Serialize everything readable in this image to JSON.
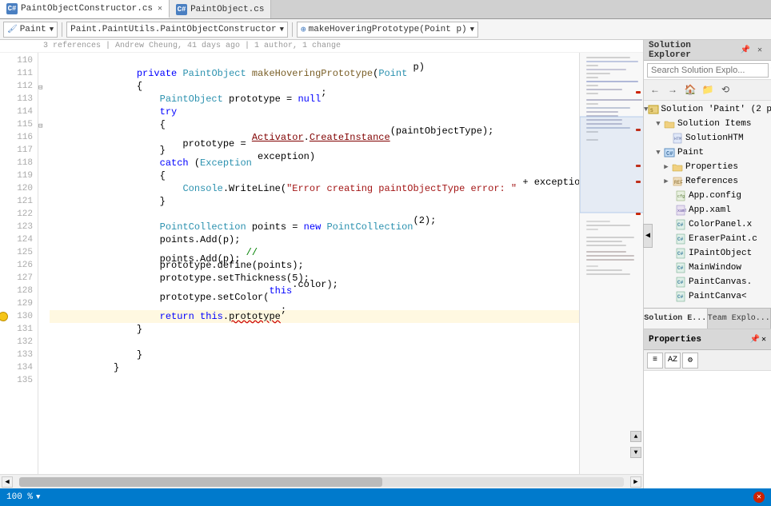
{
  "tabs": [
    {
      "id": "tab1",
      "label": "PaintObjectConstructor.cs",
      "icon": "C#",
      "active": false,
      "modified": true
    },
    {
      "id": "tab2",
      "label": "PaintObject.cs",
      "icon": "C#",
      "active": true,
      "modified": false
    }
  ],
  "toolbar": {
    "scope_label": "Paint",
    "nav_label": "Paint.PaintUtils.PaintObjectConstructor",
    "method_label": "⊕ makeHoveringPrototype(Point p)"
  },
  "editor": {
    "metadata_line": "3 references | Andrew Cheung, 41 days ago | 1 author, 1 change",
    "lines": [
      {
        "num": 110,
        "indent": 0,
        "content": "",
        "parts": []
      },
      {
        "num": 111,
        "indent": 1,
        "content": "private PaintObject makeHoveringPrototype(Point p)",
        "collapsible": true
      },
      {
        "num": 112,
        "indent": 1,
        "content": "{"
      },
      {
        "num": 113,
        "indent": 2,
        "content": "PaintObject prototype = null;"
      },
      {
        "num": 114,
        "indent": 2,
        "content": "try",
        "collapsible": true
      },
      {
        "num": 115,
        "indent": 2,
        "content": "{"
      },
      {
        "num": 116,
        "indent": 3,
        "content": "prototype = Activator.CreateInstance(paintObjectType);"
      },
      {
        "num": 117,
        "indent": 2,
        "content": "}"
      },
      {
        "num": 118,
        "indent": 2,
        "content": "catch (Exception exception)"
      },
      {
        "num": 119,
        "indent": 2,
        "content": "{"
      },
      {
        "num": 120,
        "indent": 3,
        "content": "Console.WriteLine(\"Error creating paintObjectType error: \" + exception.Me"
      },
      {
        "num": 121,
        "indent": 2,
        "content": "}"
      },
      {
        "num": 122,
        "indent": 0,
        "content": ""
      },
      {
        "num": 123,
        "indent": 2,
        "content": "PointCollection points = new PointCollection(2);"
      },
      {
        "num": 124,
        "indent": 2,
        "content": "points.Add(p);"
      },
      {
        "num": 125,
        "indent": 2,
        "content": "points.Add(p); //"
      },
      {
        "num": 126,
        "indent": 2,
        "content": "prototype.define(points);"
      },
      {
        "num": 127,
        "indent": 2,
        "content": "prototype.setThickness(5);"
      },
      {
        "num": 128,
        "indent": 2,
        "content": "prototype.setColor(this.color);"
      },
      {
        "num": 129,
        "indent": 0,
        "content": ""
      },
      {
        "num": 130,
        "indent": 2,
        "content": "return this.prototype;",
        "has_warning": true
      },
      {
        "num": 131,
        "indent": 1,
        "content": "}"
      },
      {
        "num": 132,
        "indent": 0,
        "content": ""
      },
      {
        "num": 133,
        "indent": 1,
        "content": "}"
      },
      {
        "num": 134,
        "indent": 0,
        "content": "}"
      },
      {
        "num": 135,
        "indent": 0,
        "content": ""
      }
    ]
  },
  "solution_explorer": {
    "title": "Solution Explorer",
    "search_placeholder": "Search Solution Explo...",
    "toolbar_buttons": [
      "←",
      "→",
      "🏠",
      "📁",
      "⟲"
    ],
    "tree": [
      {
        "id": "solution",
        "label": "Solution 'Paint' (2 p",
        "icon": "sol",
        "depth": 0,
        "expanded": true
      },
      {
        "id": "solution-items",
        "label": "Solution Items",
        "icon": "folder",
        "depth": 1,
        "expanded": true
      },
      {
        "id": "solutionhtml",
        "label": "SolutionHTM",
        "icon": "file",
        "depth": 2,
        "expanded": false
      },
      {
        "id": "paint",
        "label": "Paint",
        "icon": "cs-proj",
        "depth": 1,
        "expanded": true,
        "selected": false
      },
      {
        "id": "properties",
        "label": "Properties",
        "icon": "folder",
        "depth": 2,
        "expanded": false
      },
      {
        "id": "references",
        "label": "References",
        "icon": "ref",
        "depth": 2,
        "expanded": false
      },
      {
        "id": "appconfig",
        "label": "App.config",
        "icon": "config",
        "depth": 2
      },
      {
        "id": "appxaml",
        "label": "App.xaml",
        "icon": "xaml",
        "depth": 2
      },
      {
        "id": "colorpanel",
        "label": "ColorPanel.x",
        "icon": "cs",
        "depth": 2
      },
      {
        "id": "eraserpaint",
        "label": "EraserPaint.c",
        "icon": "cs",
        "depth": 2
      },
      {
        "id": "ipaintobject",
        "label": "IPaintObject",
        "icon": "cs",
        "depth": 2
      },
      {
        "id": "mainwindow",
        "label": "MainWindow",
        "icon": "cs",
        "depth": 2
      },
      {
        "id": "paintcanvas1",
        "label": "PaintCanvas.",
        "icon": "cs",
        "depth": 2
      },
      {
        "id": "paintcanvas2",
        "label": "PaintCanva<",
        "icon": "cs",
        "depth": 2
      }
    ]
  },
  "panel_tabs": [
    {
      "label": "Solution E...",
      "active": true
    },
    {
      "label": "Team Explo...",
      "active": false
    }
  ],
  "properties_panel": {
    "title": "Properties"
  },
  "status_bar": {
    "zoom": "100 %",
    "error_icon": "✕"
  }
}
